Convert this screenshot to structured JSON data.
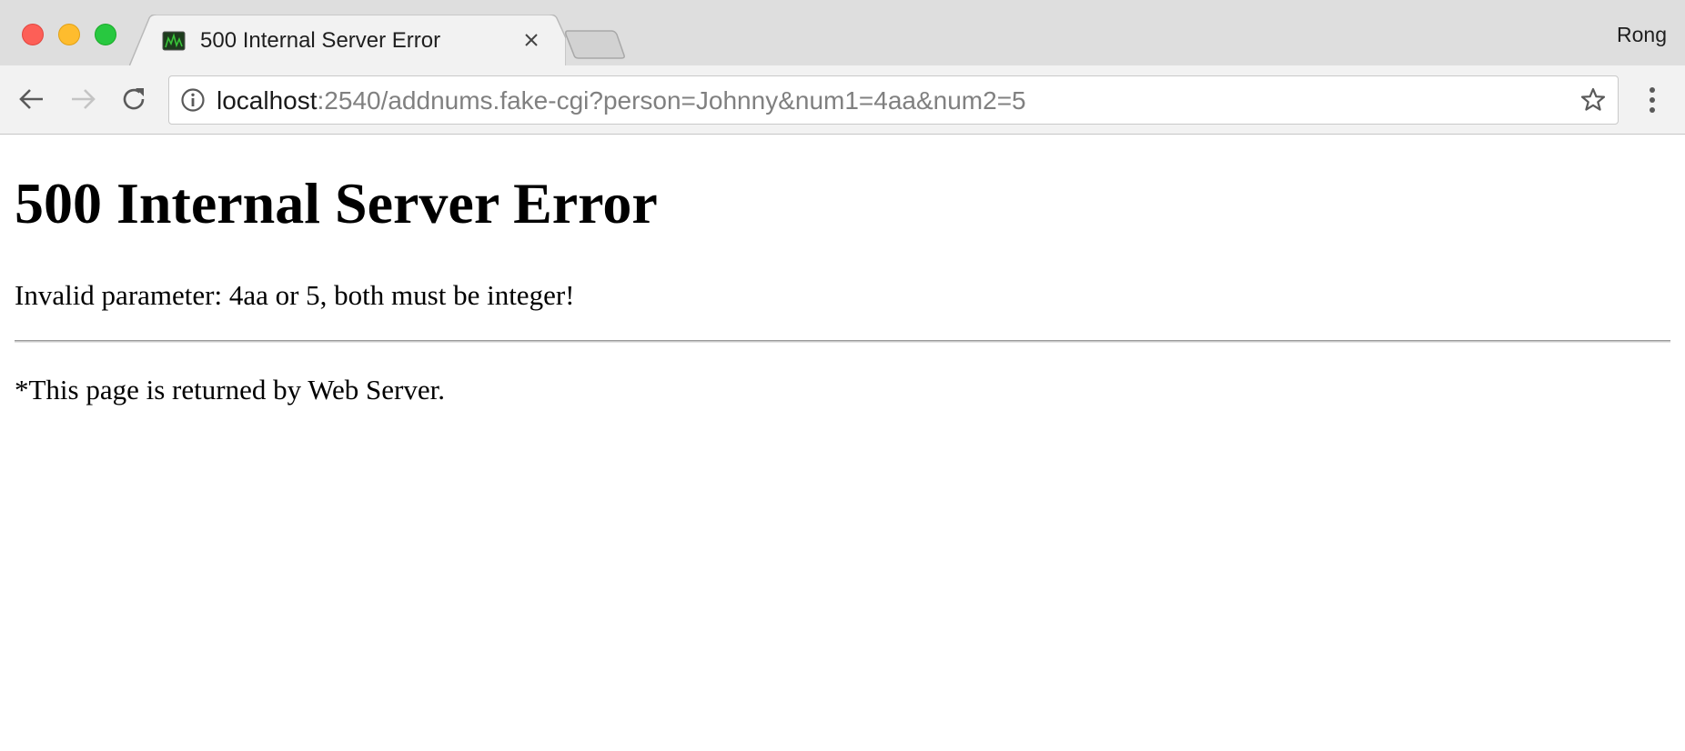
{
  "window": {
    "traffic_lights": [
      "close",
      "minimize",
      "maximize"
    ],
    "profile_name": "Rong"
  },
  "tab": {
    "title": "500 Internal Server Error",
    "favicon": "terminal-icon"
  },
  "toolbar": {
    "url_host": "localhost",
    "url_rest": ":2540/addnums.fake-cgi?person=Johnny&num1=4aa&num2=5",
    "icons": [
      "back-arrow-icon",
      "forward-arrow-icon",
      "reload-icon",
      "info-icon",
      "star-icon",
      "menu-kebab-icon"
    ]
  },
  "page": {
    "title": "500 Internal Server Error",
    "message": "Invalid parameter: 4aa or 5, both must be integer!",
    "footer_note": "*This page is returned by Web Server."
  },
  "colors": {
    "tabstrip_bg": "#dedede",
    "toolbar_bg": "#f2f2f2",
    "close_light": "#fd5f57",
    "min_light": "#febc2e",
    "max_light": "#28c840",
    "url_host_color": "#1a1a1a",
    "url_rest_color": "#808080"
  }
}
